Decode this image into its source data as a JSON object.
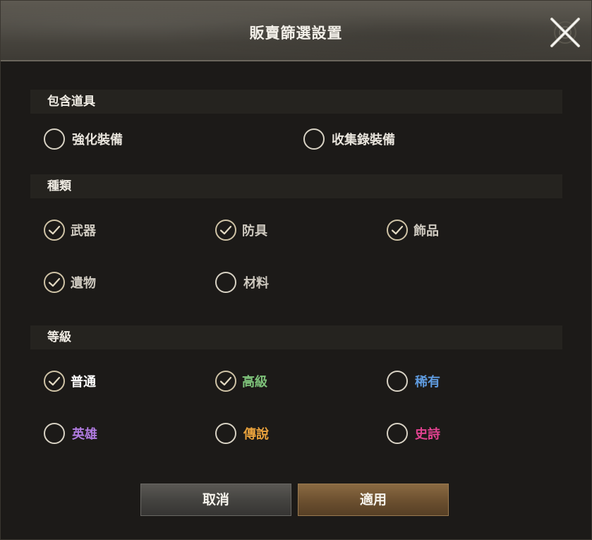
{
  "dialog": {
    "title": "販賣篩選設置"
  },
  "sections": {
    "include_items": {
      "header": "包含道具",
      "options": [
        {
          "label": "強化裝備",
          "checked": false
        },
        {
          "label": "收集錄裝備",
          "checked": false
        }
      ]
    },
    "type": {
      "header": "種類",
      "options": [
        {
          "label": "武器",
          "checked": true
        },
        {
          "label": "防具",
          "checked": true
        },
        {
          "label": "飾品",
          "checked": true
        },
        {
          "label": "遺物",
          "checked": true
        },
        {
          "label": "材料",
          "checked": false
        }
      ]
    },
    "grade": {
      "header": "等級",
      "options": [
        {
          "label": "普通",
          "checked": true,
          "color": "#ffffff"
        },
        {
          "label": "高級",
          "checked": true,
          "color": "#7ec27a"
        },
        {
          "label": "稀有",
          "checked": false,
          "color": "#5f9bdf"
        },
        {
          "label": "英雄",
          "checked": false,
          "color": "#b07be0"
        },
        {
          "label": "傳說",
          "checked": false,
          "color": "#e9a23c"
        },
        {
          "label": "史詩",
          "checked": false,
          "color": "#e0428f"
        }
      ]
    }
  },
  "buttons": {
    "cancel": "取消",
    "apply": "適用"
  },
  "icons": {
    "close": "close-icon",
    "radio": "radio-empty-icon",
    "check": "checkmark-circle-icon"
  },
  "colors": {
    "title_bar": "#4c4942",
    "background": "#1c1a18",
    "cancel_button": "#43423f",
    "apply_button": "#6b4f2f"
  }
}
